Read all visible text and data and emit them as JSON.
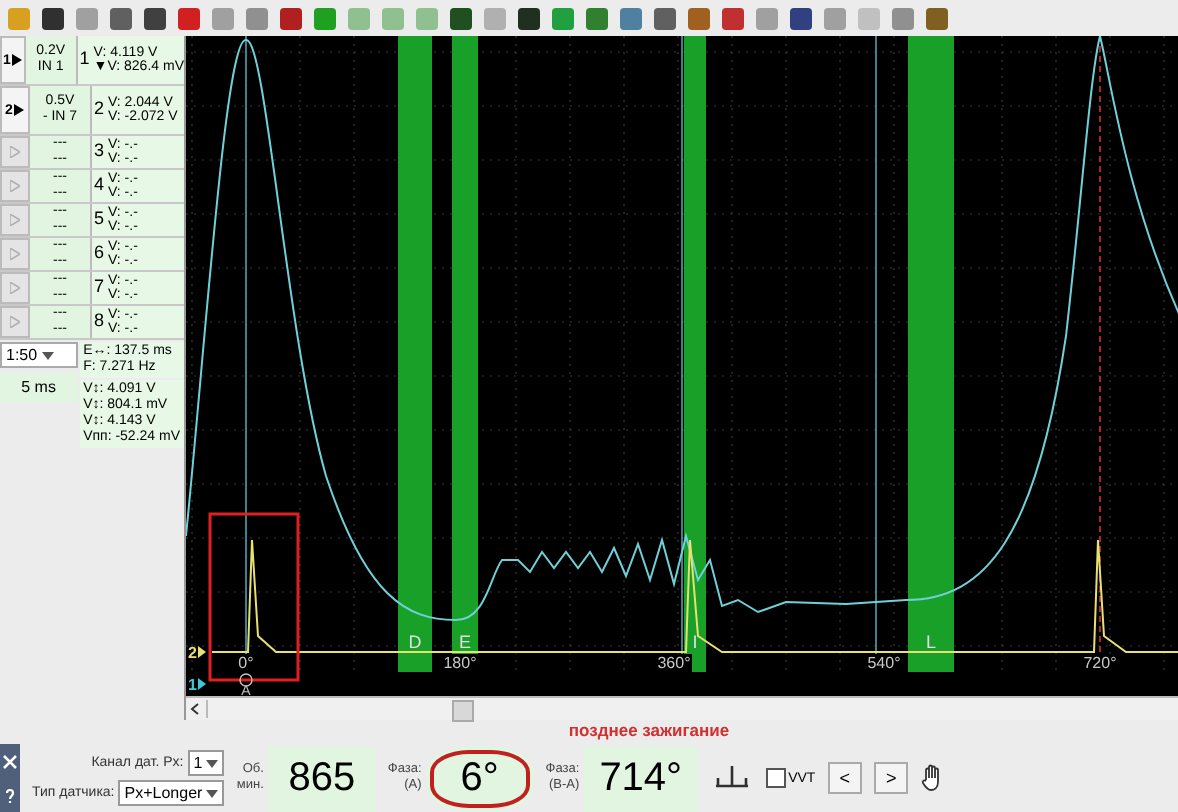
{
  "channels": [
    {
      "button": "1",
      "enabled": true,
      "scale": "0.2V",
      "input": "IN 1",
      "index": "1",
      "readings": [
        {
          "label": "V:",
          "value": "4.119 V"
        },
        {
          "label": "▼V:",
          "value": "826.4 mV"
        }
      ]
    },
    {
      "button": "2",
      "enabled": true,
      "scale": "0.5V",
      "input": "- IN 7",
      "index": "2",
      "readings": [
        {
          "label": "V:",
          "value": "2.044 V"
        },
        {
          "label": "V:",
          "value": "-2.072 V"
        }
      ]
    },
    {
      "enabled": false,
      "scale": "---",
      "input": "---",
      "index": "3",
      "readings": [
        {
          "label": "V:",
          "value": "-.-"
        },
        {
          "label": "V:",
          "value": "-.-"
        }
      ]
    },
    {
      "enabled": false,
      "scale": "---",
      "input": "---",
      "index": "4",
      "readings": [
        {
          "label": "V:",
          "value": "-.-"
        },
        {
          "label": "V:",
          "value": "-.-"
        }
      ]
    },
    {
      "enabled": false,
      "scale": "---",
      "input": "---",
      "index": "5",
      "readings": [
        {
          "label": "V:",
          "value": "-.-"
        },
        {
          "label": "V:",
          "value": "-.-"
        }
      ]
    },
    {
      "enabled": false,
      "scale": "---",
      "input": "---",
      "index": "6",
      "readings": [
        {
          "label": "V:",
          "value": "-.-"
        },
        {
          "label": "V:",
          "value": "-.-"
        }
      ]
    },
    {
      "enabled": false,
      "scale": "---",
      "input": "---",
      "index": "7",
      "readings": [
        {
          "label": "V:",
          "value": "-.-"
        },
        {
          "label": "V:",
          "value": "-.-"
        }
      ]
    },
    {
      "enabled": false,
      "scale": "---",
      "input": "---",
      "index": "8",
      "readings": [
        {
          "label": "V:",
          "value": "-.-"
        },
        {
          "label": "V:",
          "value": "-.-"
        }
      ]
    }
  ],
  "zoom": "1:50",
  "timebase": "5 ms",
  "timing": [
    {
      "label": "E↔:",
      "value": "137.5 ms"
    },
    {
      "label": "F:",
      "value": "7.271 Hz"
    }
  ],
  "levels": [
    {
      "label": "V↕:",
      "value": "4.091 V"
    },
    {
      "label": "V↕:",
      "value": "804.1 mV"
    },
    {
      "label": "V↕:",
      "value": "4.143 V"
    },
    {
      "label": "Vпп:",
      "value": "-52.24 mV"
    }
  ],
  "scope": {
    "bands": [
      {
        "label": "D"
      },
      {
        "label": "E"
      },
      {
        "label": "I"
      },
      {
        "label": "L"
      }
    ],
    "angle_labels": [
      "0°",
      "180°",
      "360°",
      "540°",
      "720°"
    ],
    "trace_markers": [
      {
        "label": "2",
        "color": "#e8e070"
      },
      {
        "label": "1",
        "color": "#40c8d8"
      }
    ],
    "cursor_label": "A"
  },
  "warning": "позднее зажигание",
  "sensor_channel": {
    "label": "Канал дат. Рх:",
    "value": "1"
  },
  "sensor_type": {
    "label": "Тип датчика:",
    "value": "Px+Longer"
  },
  "rpm": {
    "label": [
      "Об.",
      "мин."
    ],
    "value": "865"
  },
  "phase_a": {
    "label": [
      "Фаза:",
      "(A)"
    ],
    "value": "6°",
    "circled": true
  },
  "phase_ba": {
    "label": [
      "Фаза:",
      "(B-A)"
    ],
    "value": "714°",
    "circled": false
  },
  "vvt": {
    "label": "VVT",
    "checked": false
  },
  "nav": [
    "<",
    ">"
  ]
}
